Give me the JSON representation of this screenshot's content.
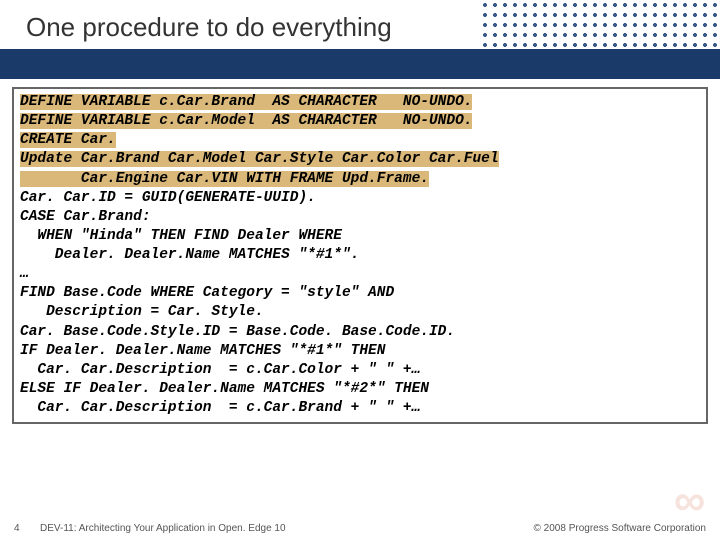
{
  "slide": {
    "title": "One procedure to do everything",
    "number": "4",
    "footer_mid": "DEV-11: Architecting Your Application in Open. Edge 10",
    "footer_right": "© 2008 Progress Software Corporation"
  },
  "code": {
    "l1a": "DEFINE VARIABLE c.Car.Brand  AS CHARACTER   NO-UNDO.",
    "l2a": "DEFINE VARIABLE c.Car.Model  AS CHARACTER   NO-UNDO.",
    "l3a": "CREATE Car.",
    "l4a": "Update Car.Brand Car.Model Car.Style Car.Color Car.Fuel",
    "l5a": "       Car.Engine Car.VIN WITH FRAME Upd.Frame.",
    "l6": "Car. Car.ID = GUID(GENERATE-UUID).",
    "l7": "CASE Car.Brand:",
    "l8": "  WHEN \"Hinda\" THEN FIND Dealer WHERE",
    "l9": "    Dealer. Dealer.Name MATCHES \"*#1*\".",
    "l10": "…",
    "l11": "FIND Base.Code WHERE Category = \"style\" AND",
    "l12": "   Description = Car. Style.",
    "l13": "Car. Base.Code.Style.ID = Base.Code. Base.Code.ID.",
    "l14": "IF Dealer. Dealer.Name MATCHES \"*#1*\" THEN",
    "l15": "  Car. Car.Description  = c.Car.Color + \" \" +…",
    "l16": "ELSE IF Dealer. Dealer.Name MATCHES \"*#2*\" THEN",
    "l17": "  Car. Car.Description  = c.Car.Brand + \" \" +…"
  }
}
